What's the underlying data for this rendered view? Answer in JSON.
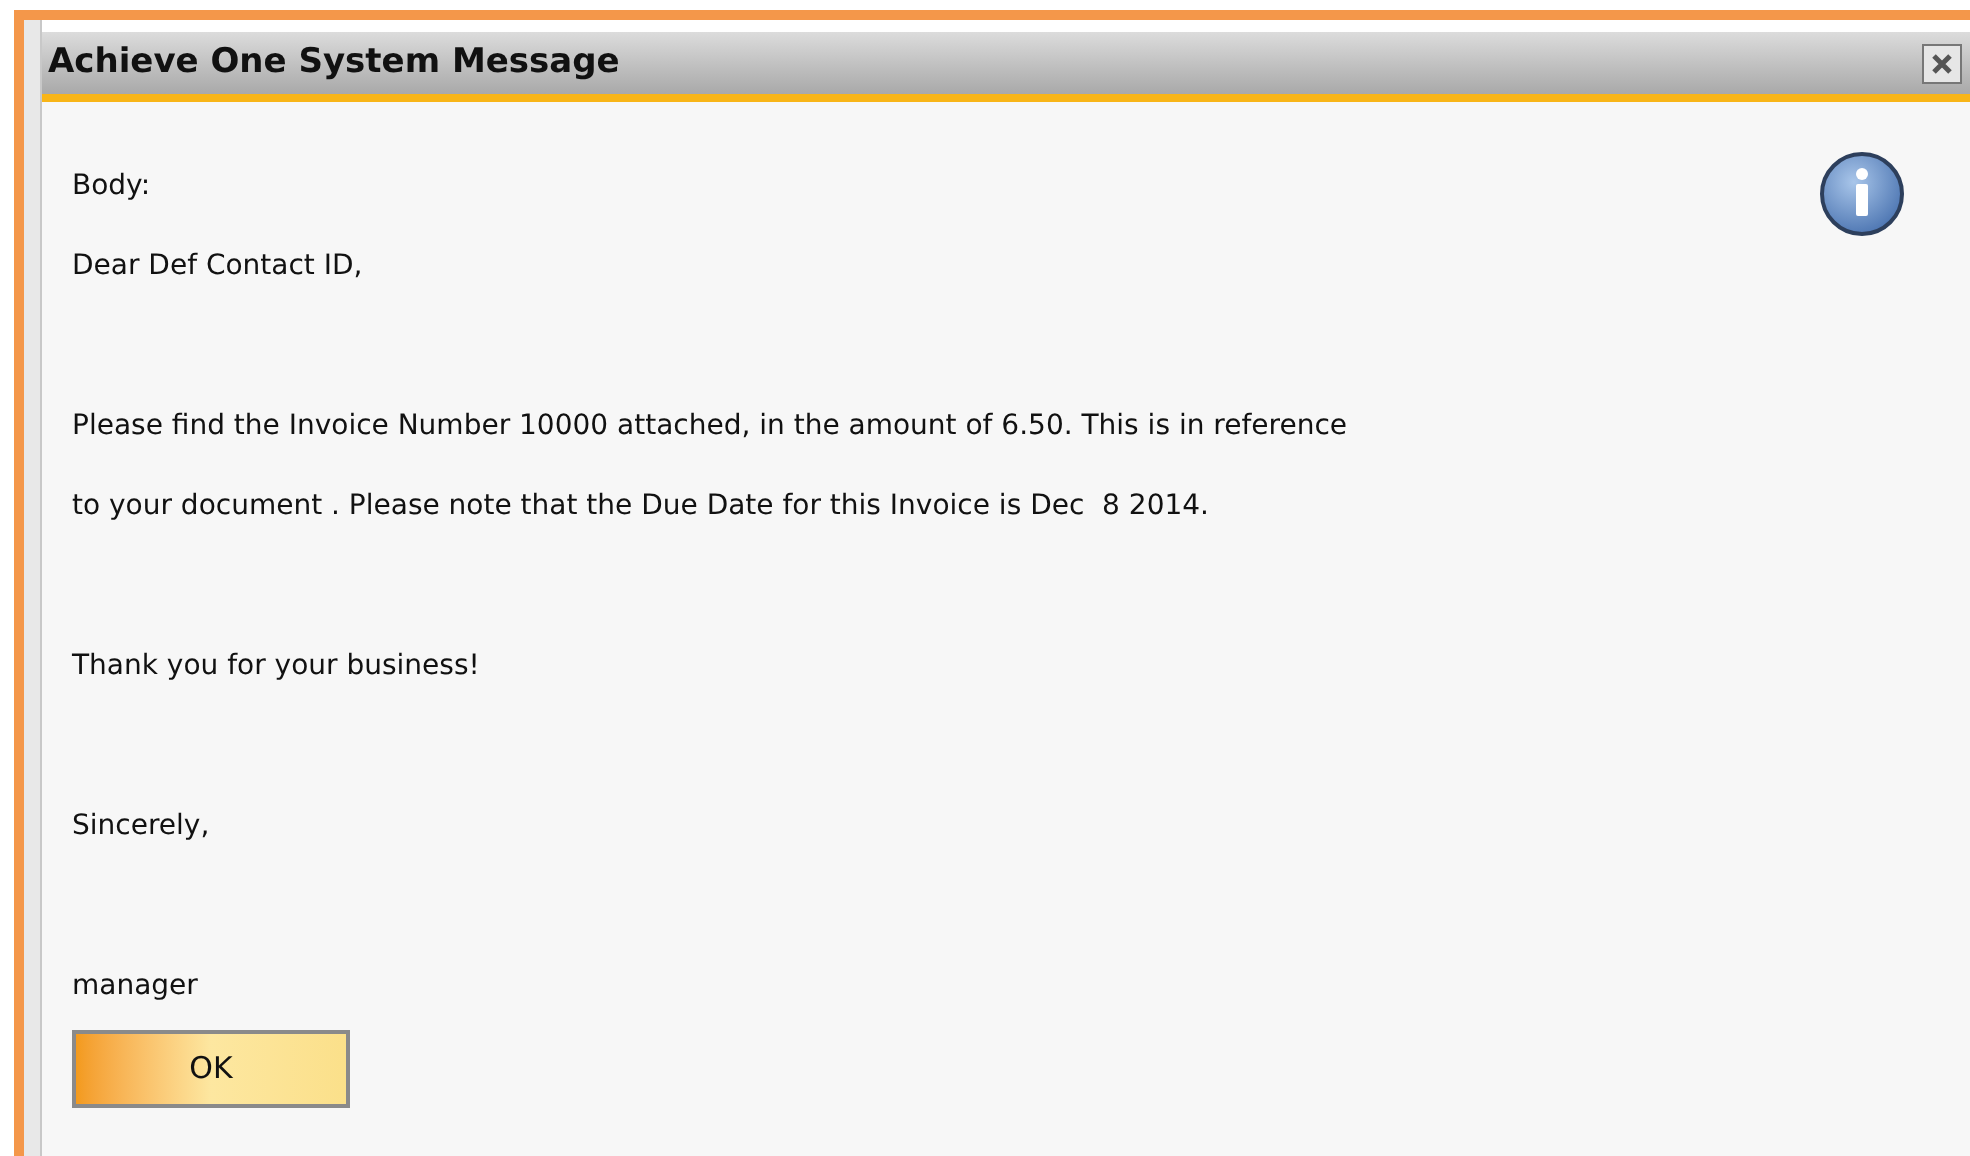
{
  "window": {
    "title": "Achieve One System Message"
  },
  "message": {
    "paragraphs": [
      [
        "Body:",
        "Dear Def Contact ID,"
      ],
      [
        "Please find the Invoice Number 10000 attached, in the amount of 6.50. This is in reference",
        "to your document . Please note that the Due Date for this Invoice is Dec  8 2014."
      ],
      [
        "Thank you for your business!"
      ],
      [
        "Sincerely,"
      ],
      [
        "manager"
      ]
    ]
  },
  "buttons": [
    "OK"
  ]
}
